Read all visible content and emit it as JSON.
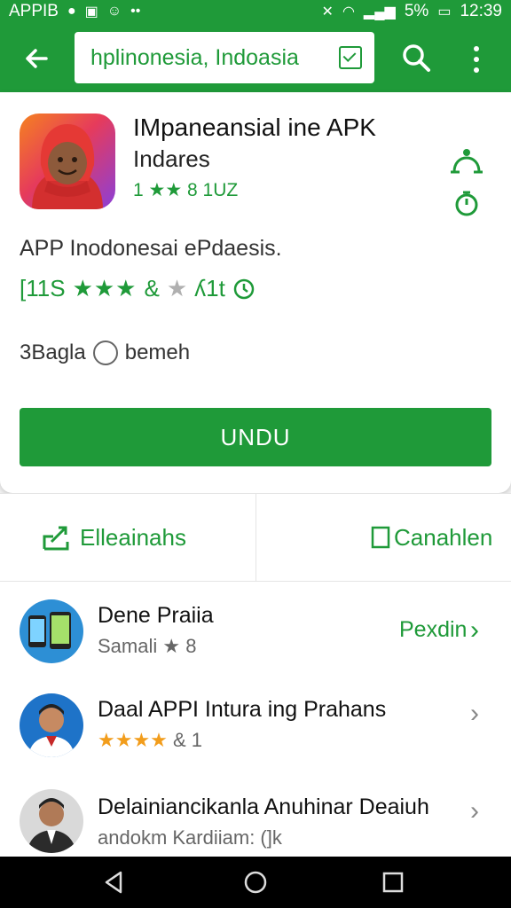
{
  "status": {
    "left_text": "APPIB",
    "battery": "5%",
    "time": "12:39"
  },
  "search": {
    "query": "hplinonesia, Indoasia"
  },
  "app": {
    "title": "IMpaneansial ine APK",
    "subtitle": "Indares",
    "rating_text": "1 ★★ 8  1UZ",
    "description": "APP Inodonesai ePdaesis.",
    "rating_prefix": "[11S",
    "rating_suffix": "&",
    "rating_extra": "ʎ1t",
    "meta_left": "3Bagla",
    "meta_right": "bemeh",
    "install_label": "UNDU"
  },
  "actions": {
    "left_label": "Elleainahs",
    "right_label": "Canahlen"
  },
  "list": [
    {
      "title": "Dene Praiia",
      "subtitle": "Samali ★ 8",
      "action": "Pexdin"
    },
    {
      "title": "Daal APPI Intura ing Prahans",
      "subtitle_stars": "★★★★",
      "subtitle_rest": "& 1"
    },
    {
      "title": "Delainiancikanla Anuhinar Deaiuh",
      "subtitle": "andokm Kardiiam: (]k"
    }
  ],
  "colors": {
    "brand_green": "#1f9a39",
    "star_orange": "#f29d1c"
  }
}
